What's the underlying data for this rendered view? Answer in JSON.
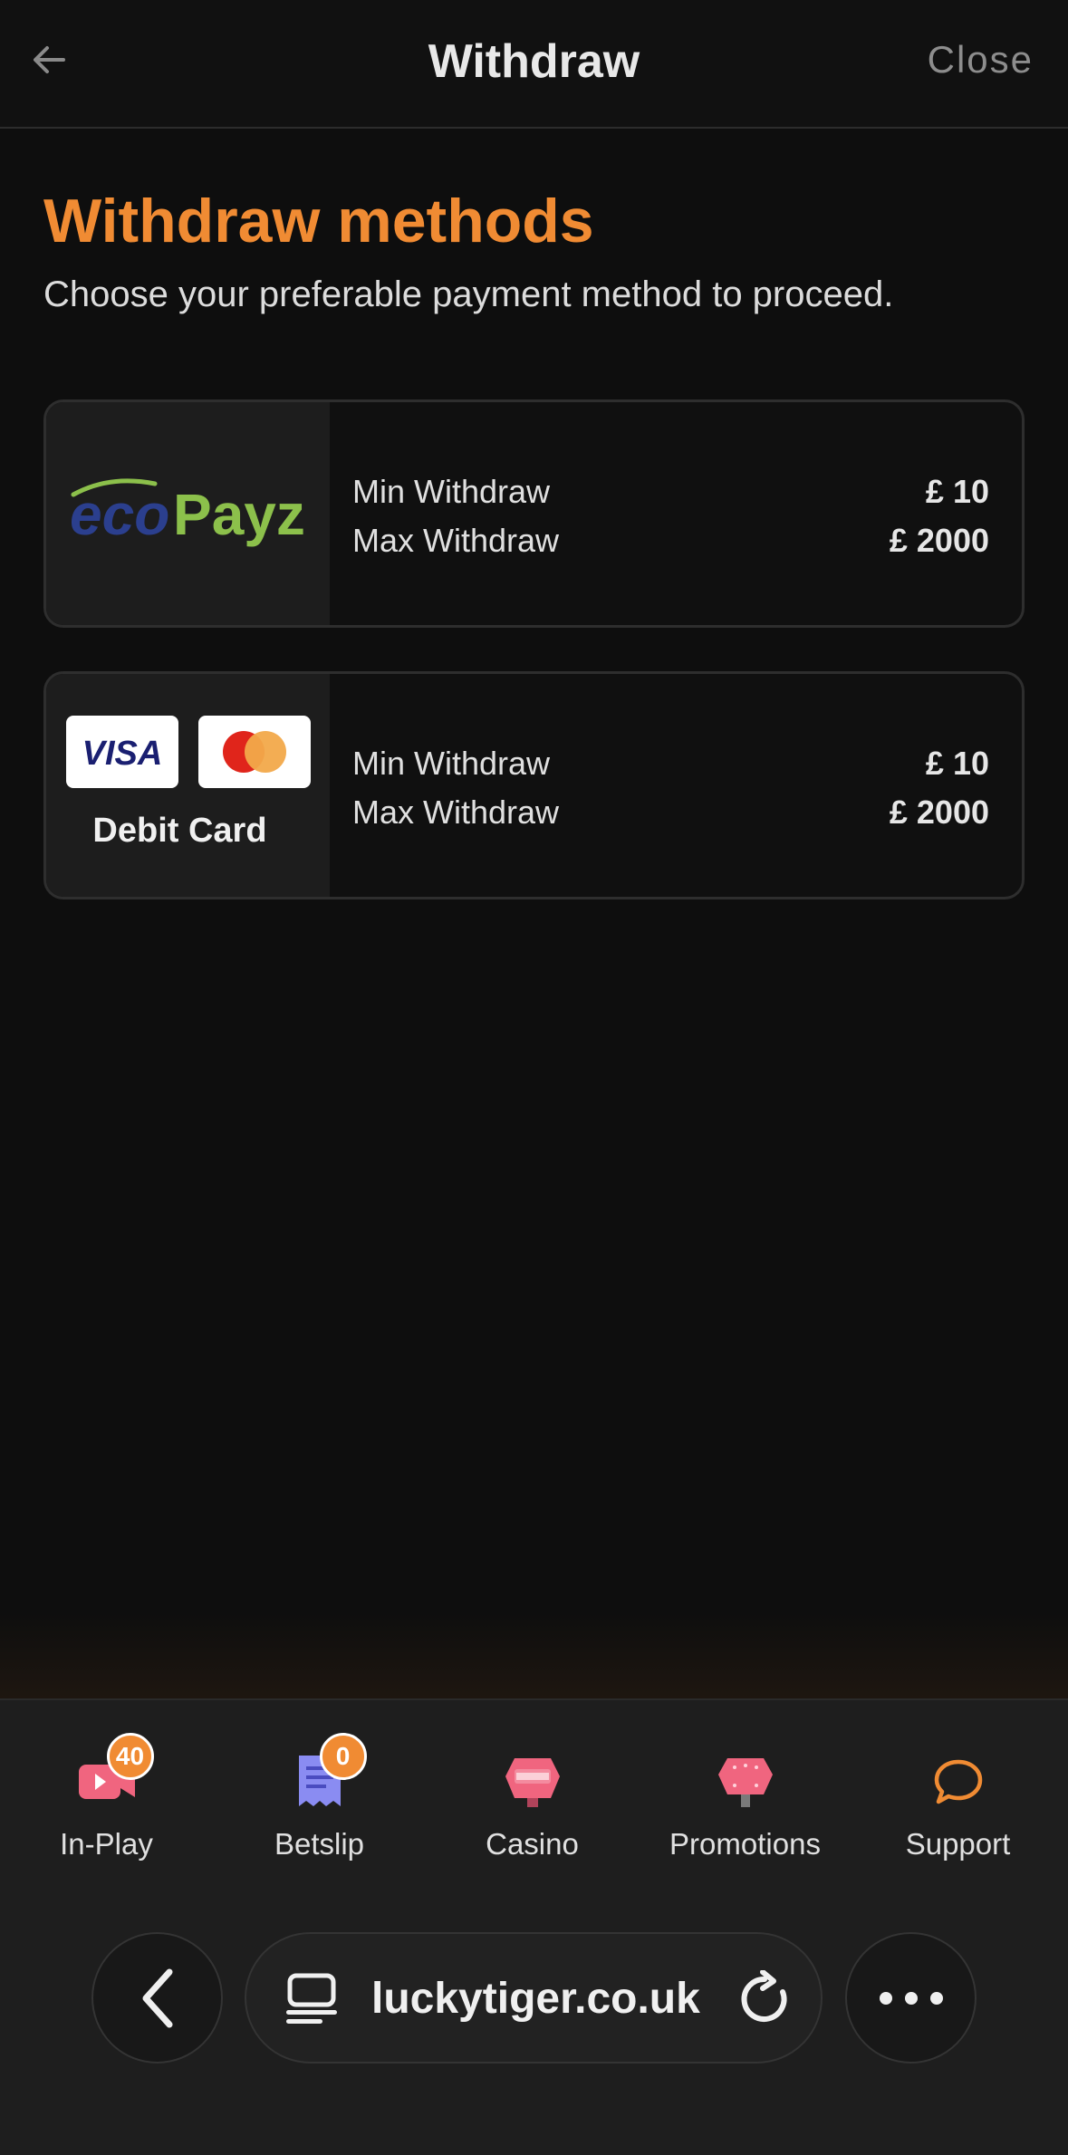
{
  "header": {
    "title": "Withdraw",
    "close_label": "Close"
  },
  "main": {
    "title": "Withdraw methods",
    "subtitle": "Choose your preferable payment method to proceed.",
    "methods": [
      {
        "name": "ecoPayz",
        "logo_text_1": "eco",
        "logo_text_2": "Payz",
        "min_label": "Min Withdraw",
        "min_value": "£ 10",
        "max_label": "Max Withdraw",
        "max_value": "£ 2000"
      },
      {
        "name": "Debit Card",
        "visa_text": "VISA",
        "min_label": "Min Withdraw",
        "min_value": "£ 10",
        "max_label": "Max Withdraw",
        "max_value": "£ 2000"
      }
    ]
  },
  "tabbar": {
    "items": [
      {
        "label": "In-Play",
        "badge": "40",
        "icon": "video-camera-icon"
      },
      {
        "label": "Betslip",
        "badge": "0",
        "icon": "receipt-icon"
      },
      {
        "label": "Casino",
        "icon": "casino-chip-icon"
      },
      {
        "label": "Promotions",
        "icon": "promotions-sign-icon"
      },
      {
        "label": "Support",
        "icon": "chat-bubble-icon"
      }
    ]
  },
  "browser": {
    "url": "luckytiger.co.uk"
  },
  "colors": {
    "accent": "#f08b33",
    "background": "#0e0e0e",
    "card_panel": "#1d1d1d",
    "ecopayz_blue": "#2b3f8e",
    "ecopayz_green": "#8cc04b",
    "visa_blue": "#1a1f71",
    "mastercard_red": "#eb001b",
    "mastercard_orange": "#f79e1b",
    "tab_icon_pink": "#f0657f",
    "tab_icon_purple": "#8a8cf2"
  }
}
